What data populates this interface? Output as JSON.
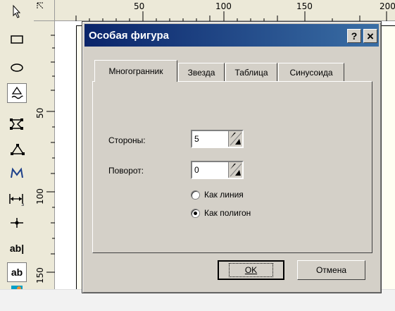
{
  "ruler": {
    "top_ticks": [
      "50",
      "100",
      "150",
      "200"
    ],
    "left_ticks": [
      "50",
      "100",
      "150"
    ]
  },
  "toolbox": {
    "text_tool_label": "ab|",
    "frame_text_tool_label": "ab"
  },
  "dialog": {
    "title": "Особая фигура",
    "help_label": "?",
    "close_label": "×",
    "tabs": [
      "Многогранник",
      "Звезда",
      "Таблица",
      "Синусоида"
    ],
    "selected_tab": "Многогранник",
    "fields": {
      "sides_label": "Стороны:",
      "sides_value": "5",
      "rotation_label": "Поворот:",
      "rotation_value": "0"
    },
    "radios": {
      "as_line_label": "Как линия",
      "as_polygon_label": "Как полигон",
      "selected": "as_polygon"
    },
    "buttons": {
      "ok_label": "OK",
      "cancel_label": "Отмена"
    }
  },
  "colors": {
    "titlebar_start": "#0a246a",
    "titlebar_end": "#3a6ea5",
    "dialog_face": "#d4d0c8"
  }
}
